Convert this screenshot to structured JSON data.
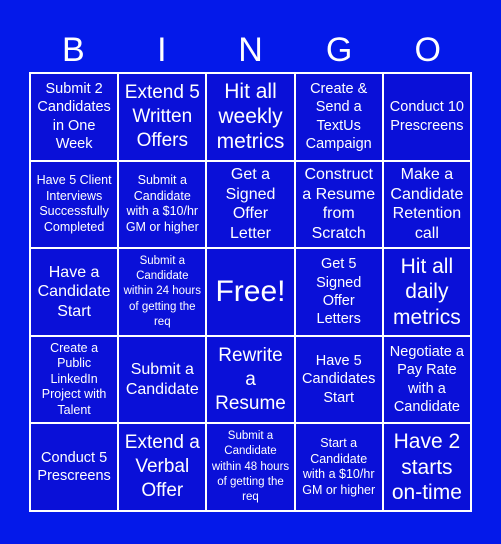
{
  "header": {
    "letters": [
      "B",
      "I",
      "N",
      "G",
      "O"
    ]
  },
  "colors": {
    "background": "#0419ea",
    "cell": "#0a10d8",
    "lines": "#ffffff",
    "text": "#ffffff"
  },
  "board": {
    "rows": [
      [
        "Submit 2 Candidates in One Week",
        "Extend 5 Written Offers",
        "Hit all weekly metrics",
        "Create & Send a TextUs Campaign",
        "Conduct 10 Prescreens"
      ],
      [
        "Have 5 Client Interviews Successfully Completed",
        "Submit a Candidate with a $10/hr GM or higher",
        "Get a Signed Offer Letter",
        "Construct a Resume from Scratch",
        "Make a Candidate Retention call"
      ],
      [
        "Have a Candidate Start",
        "Submit a Candidate within 24 hours of getting the req",
        "Free!",
        "Get 5 Signed Offer Letters",
        "Hit all daily metrics"
      ],
      [
        "Create a Public LinkedIn Project with Talent",
        "Submit a Candidate",
        "Rewrite a Resume",
        "Have 5 Candidates Start",
        "Negotiate a Pay Rate with a Candidate"
      ],
      [
        "Conduct 5 Prescreens",
        "Extend a Verbal Offer",
        "Submit a Candidate within 48 hours of getting the req",
        "Start a Candidate with a $10/hr GM or higher",
        "Have 2 starts on-time"
      ]
    ]
  }
}
